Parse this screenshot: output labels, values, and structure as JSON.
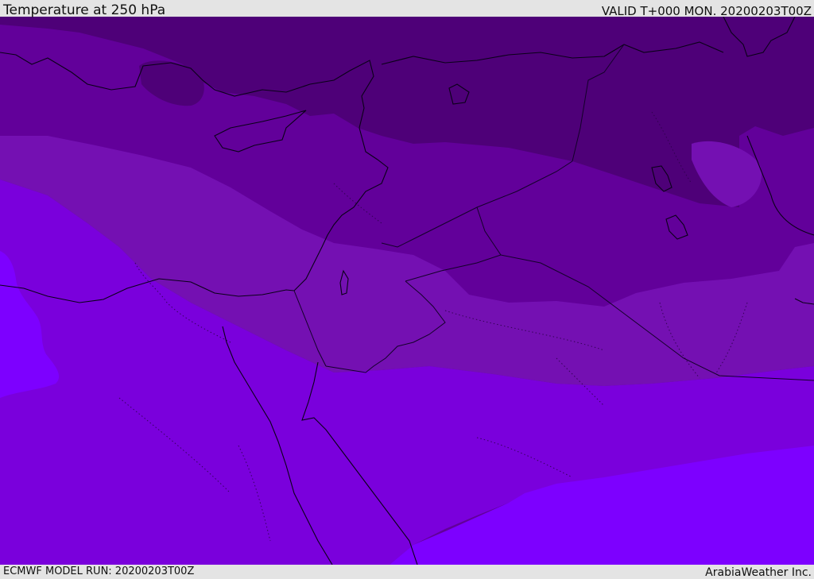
{
  "header": {
    "title": "Temperature at 250 hPa",
    "valid_time": "VALID T+000 MON. 20200203T00Z"
  },
  "footer": {
    "model_run": "ECMWF MODEL RUN: 20200203T00Z",
    "credit": "ArabiaWeather Inc."
  },
  "map": {
    "colors": {
      "band_coldest": "#4e0078",
      "band_cold": "#62009a",
      "band_mid": "#7410b2",
      "band_warm": "#7a00dc",
      "band_warmest": "#7d00ff",
      "coastline": "#0a0018",
      "border": "#14002a"
    }
  }
}
